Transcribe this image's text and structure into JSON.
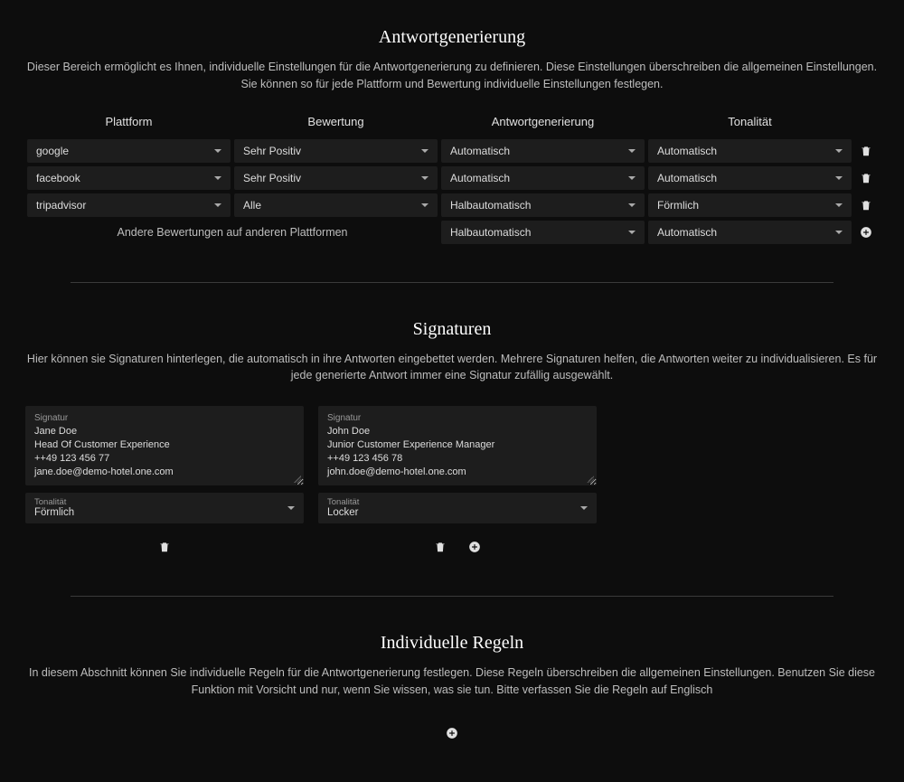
{
  "responseGen": {
    "title": "Antwortgenerierung",
    "desc": "Dieser Bereich ermöglicht es Ihnen, individuelle Einstellungen für die Antwortgenerierung zu definieren. Diese Einstellungen überschreiben die allgemeinen Einstellungen. Sie können so für jede Plattform und Bewertung individuelle Einstellungen festlegen.",
    "headers": {
      "platform": "Plattform",
      "rating": "Bewertung",
      "generation": "Antwortgenerierung",
      "tonality": "Tonalität"
    },
    "rows": [
      {
        "platform": "google",
        "rating": "Sehr Positiv",
        "generation": "Automatisch",
        "tonality": "Automatisch"
      },
      {
        "platform": "facebook",
        "rating": "Sehr Positiv",
        "generation": "Automatisch",
        "tonality": "Automatisch"
      },
      {
        "platform": "tripadvisor",
        "rating": "Alle",
        "generation": "Halbautomatisch",
        "tonality": "Förmlich"
      }
    ],
    "defaultLabel": "Andere Bewertungen auf anderen Plattformen",
    "defaultRow": {
      "generation": "Halbautomatisch",
      "tonality": "Automatisch"
    }
  },
  "signatures": {
    "title": "Signaturen",
    "desc": "Hier können sie Signaturen hinterlegen, die automatisch in ihre Antworten eingebettet werden. Mehrere Signaturen helfen, die Antworten weiter zu individualisieren. Es für jede generierte Antwort immer eine Signatur zufällig ausgewählt.",
    "fieldLabel": "Signatur",
    "tonalityLabel": "Tonalität",
    "items": [
      {
        "text": "Jane Doe\nHead Of Customer Experience\n++49 123 456 77\njane.doe@demo-hotel.one.com",
        "tonality": "Förmlich"
      },
      {
        "text": "John Doe\nJunior Customer Experience Manager\n++49 123 456 78\njohn.doe@demo-hotel.one.com",
        "tonality": "Locker"
      }
    ]
  },
  "rules": {
    "title": "Individuelle Regeln",
    "desc": "In diesem Abschnitt können Sie individuelle Regeln für die Antwortgenerierung festlegen. Diese Regeln überschreiben die allgemeinen Einstellungen. Benutzen Sie diese Funktion mit Vorsicht und nur, wenn Sie wissen, was sie tun. Bitte verfassen Sie die Regeln auf Englisch"
  }
}
